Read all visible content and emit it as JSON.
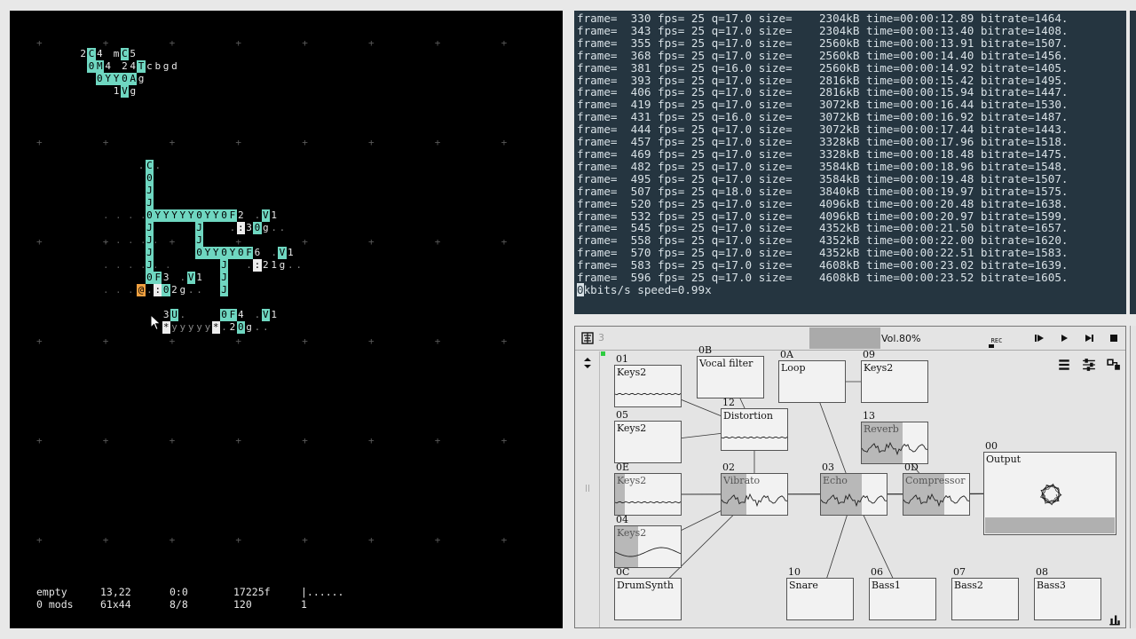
{
  "orca": {
    "grid": [
      {
        "x": 0,
        "y": 3,
        "text": "2C4 mC5",
        "style": "c-in"
      },
      {
        "x": 1,
        "y": 4,
        "text": "0M4 24Tcbgd",
        "style": "c-in"
      },
      {
        "x": 2,
        "y": 5,
        "text": "0YY0Ag",
        "style": "c-in"
      },
      {
        "x": 4,
        "y": 6,
        "text": "1Vg",
        "style": "c-in"
      },
      {
        "x": 7,
        "y": 12,
        "text": ".C.",
        "style": "c-in"
      },
      {
        "x": 8,
        "y": 13,
        "text": "0",
        "style": "c-in"
      },
      {
        "x": 8,
        "y": 14,
        "text": "J",
        "style": "c-cell"
      },
      {
        "x": 8,
        "y": 15,
        "text": "J",
        "style": "c-cell"
      },
      {
        "x": 8,
        "y": 16,
        "text": "0YYYYY0YY0F2 .V1",
        "style": "c-in"
      },
      {
        "x": 8,
        "y": 17,
        "text": "J     J   .:30g..",
        "style": "c-in"
      },
      {
        "x": 8,
        "y": 18,
        "text": "J     J",
        "style": "c-in"
      },
      {
        "x": 8,
        "y": 19,
        "text": "J     0YY0Y0F6 .V1",
        "style": "c-in"
      },
      {
        "x": 8,
        "y": 20,
        "text": "J        J  .:21g..",
        "style": "c-in"
      },
      {
        "x": 8,
        "y": 21,
        "text": "0F3 .V1  J",
        "style": "c-in"
      },
      {
        "x": 7,
        "y": 22,
        "text": "@.:02g..  J",
        "style": "c-in"
      },
      {
        "x": 10,
        "y": 24,
        "text": "3U.    0F4 .V1",
        "style": "c-in"
      },
      {
        "x": 10,
        "y": 25,
        "text": "*yyyyy*.20g..",
        "style": "c-in"
      }
    ],
    "status": {
      "row1": [
        "empty",
        "13,22",
        "0:0",
        "17225f",
        "|......"
      ],
      "row2": [
        "0 mods",
        "61x44",
        "8/8",
        "120",
        "1"
      ]
    }
  },
  "terminal": {
    "lines": [
      "frame=  330 fps= 25 q=17.0 size=    2304kB time=00:00:12.89 bitrate=1464.",
      "frame=  343 fps= 25 q=17.0 size=    2304kB time=00:00:13.40 bitrate=1408.",
      "frame=  355 fps= 25 q=17.0 size=    2560kB time=00:00:13.91 bitrate=1507.",
      "frame=  368 fps= 25 q=17.0 size=    2560kB time=00:00:14.40 bitrate=1456.",
      "frame=  381 fps= 25 q=16.0 size=    2560kB time=00:00:14.92 bitrate=1405.",
      "frame=  393 fps= 25 q=17.0 size=    2816kB time=00:00:15.42 bitrate=1495.",
      "frame=  406 fps= 25 q=17.0 size=    2816kB time=00:00:15.94 bitrate=1447.",
      "frame=  419 fps= 25 q=17.0 size=    3072kB time=00:00:16.44 bitrate=1530.",
      "frame=  431 fps= 25 q=16.0 size=    3072kB time=00:00:16.92 bitrate=1487.",
      "frame=  444 fps= 25 q=17.0 size=    3072kB time=00:00:17.44 bitrate=1443.",
      "frame=  457 fps= 25 q=17.0 size=    3328kB time=00:00:17.96 bitrate=1518.",
      "frame=  469 fps= 25 q=17.0 size=    3328kB time=00:00:18.48 bitrate=1475.",
      "frame=  482 fps= 25 q=17.0 size=    3584kB time=00:00:18.96 bitrate=1548.",
      "frame=  495 fps= 25 q=17.0 size=    3584kB time=00:00:19.48 bitrate=1507.",
      "frame=  507 fps= 25 q=18.0 size=    3840kB time=00:00:19.97 bitrate=1575.",
      "frame=  520 fps= 25 q=17.0 size=    4096kB time=00:00:20.48 bitrate=1638.",
      "frame=  532 fps= 25 q=17.0 size=    4096kB time=00:00:20.97 bitrate=1599.",
      "frame=  545 fps= 25 q=17.0 size=    4352kB time=00:00:21.50 bitrate=1657.",
      "frame=  558 fps= 25 q=17.0 size=    4352kB time=00:00:22.00 bitrate=1620.",
      "frame=  570 fps= 25 q=17.0 size=    4352kB time=00:00:22.51 bitrate=1583.",
      "frame=  583 fps= 25 q=17.0 size=    4608kB time=00:00:23.02 bitrate=1639.",
      "frame=  596 fps= 25 q=17.0 size=    4608kB time=00:00:23.52 bitrate=1605."
    ],
    "cursor_char": "0",
    "last_line": "kbits/s speed=0.99x"
  },
  "patch": {
    "page_label": "3",
    "volume_label": "Vol.80%",
    "volume_level": 0.8,
    "rec_label": "REC",
    "nodes": [
      {
        "id": "01",
        "title": "Keys2",
        "wave": "flat",
        "fill": 0
      },
      {
        "id": "0B",
        "title": "Vocal filter",
        "wave": "none",
        "fill": 0
      },
      {
        "id": "0A",
        "title": "Loop",
        "wave": "none",
        "fill": 0
      },
      {
        "id": "09",
        "title": "Keys2",
        "wave": "none",
        "fill": 0
      },
      {
        "id": "05",
        "title": "Keys2",
        "wave": "none",
        "fill": 0
      },
      {
        "id": "12",
        "title": "Distortion",
        "wave": "flat",
        "fill": 0
      },
      {
        "id": "13",
        "title": "Reverb",
        "wave": "noisy",
        "fill": 0.62
      },
      {
        "id": "0E",
        "title": "Keys2",
        "wave": "flat",
        "fill": 0.15
      },
      {
        "id": "02",
        "title": "Vibrato",
        "wave": "noisy",
        "fill": 0.38
      },
      {
        "id": "03",
        "title": "Echo",
        "wave": "noisy",
        "fill": 0.62
      },
      {
        "id": "0D",
        "title": "Compressor",
        "wave": "noisy",
        "fill": 0.62
      },
      {
        "id": "00",
        "title": "Output",
        "wave": "none",
        "fill": 0
      },
      {
        "id": "04",
        "title": "Keys2",
        "wave": "sine",
        "fill": 0.35
      },
      {
        "id": "0C",
        "title": "DrumSynth",
        "wave": "none",
        "fill": 0
      },
      {
        "id": "10",
        "title": "Snare",
        "wave": "none",
        "fill": 0
      },
      {
        "id": "06",
        "title": "Bass1",
        "wave": "none",
        "fill": 0
      },
      {
        "id": "07",
        "title": "Bass2",
        "wave": "none",
        "fill": 0
      },
      {
        "id": "08",
        "title": "Bass3",
        "wave": "none",
        "fill": 0
      }
    ],
    "icons": {
      "logo": "app-logo-icon",
      "record": "record-icon",
      "play_from_start": "play-from-start-icon",
      "play": "play-icon",
      "step": "step-forward-icon",
      "stop": "stop-icon",
      "list": "list-icon",
      "mixer": "mixer-icon",
      "routing": "routing-icon",
      "scale": "scale-icon"
    }
  }
}
